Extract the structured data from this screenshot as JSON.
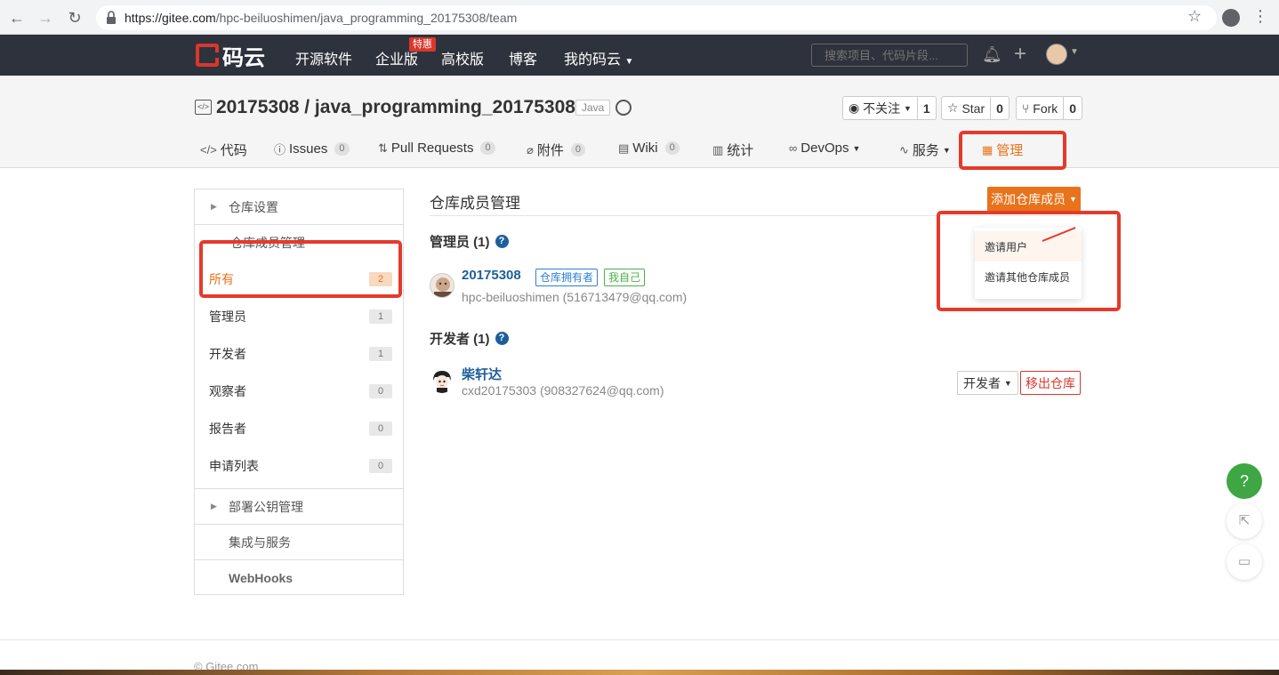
{
  "browser": {
    "url_host": "https://gitee.com",
    "url_path": "/hpc-beiluoshimen/java_programming_20175308/team"
  },
  "header": {
    "logo_text": "码云",
    "nav": [
      "开源软件",
      "企业版",
      "高校版",
      "博客",
      "我的码云"
    ],
    "hot_badge": "特惠",
    "search_placeholder": "搜索项目、代码片段..."
  },
  "repo": {
    "title": "20175308 / java_programming_20175308",
    "language": "Java",
    "watch_label": "不关注",
    "watch_count": "1",
    "star_label": "Star",
    "star_count": "0",
    "fork_label": "Fork",
    "fork_count": "0",
    "tabs": [
      {
        "label": "代码",
        "count": ""
      },
      {
        "label": "Issues",
        "count": "0"
      },
      {
        "label": "Pull Requests",
        "count": "0"
      },
      {
        "label": "附件",
        "count": "0"
      },
      {
        "label": "Wiki",
        "count": "0"
      },
      {
        "label": "统计",
        "count": ""
      },
      {
        "label": "DevOps",
        "count": ""
      },
      {
        "label": "服务",
        "count": ""
      },
      {
        "label": "管理",
        "count": ""
      }
    ]
  },
  "sidebar": {
    "repo_settings": "仓库设置",
    "member_mgmt": "仓库成员管理",
    "rows": [
      {
        "label": "所有",
        "count": "2"
      },
      {
        "label": "管理员",
        "count": "1"
      },
      {
        "label": "开发者",
        "count": "1"
      },
      {
        "label": "观察者",
        "count": "0"
      },
      {
        "label": "报告者",
        "count": "0"
      },
      {
        "label": "申请列表",
        "count": "0"
      }
    ],
    "deploy_keys": "部署公钥管理",
    "integrations": "集成与服务",
    "webhooks": "WebHooks"
  },
  "main": {
    "title": "仓库成员管理",
    "add_button": "添加仓库成员",
    "dropdown": [
      "邀请用户",
      "邀请其他仓库成员"
    ],
    "admins_title": "管理员 (1)",
    "admin": {
      "name": "20175308",
      "tag_owner": "仓库拥有者",
      "tag_self": "我自己",
      "sub": "hpc-beiluoshimen (516713479@qq.com)"
    },
    "devs_title": "开发者 (1)",
    "dev": {
      "name": "柴轩达",
      "sub": "cxd20175303 (908327624@qq.com)",
      "role": "开发者",
      "remove": "移出仓库"
    }
  },
  "footer": {
    "text": "© Gitee.com"
  },
  "colors": {
    "accent": "#e8731a",
    "highlight": "#e53a2b",
    "header_bg": "#2e323c",
    "help_green": "#3ea642"
  }
}
